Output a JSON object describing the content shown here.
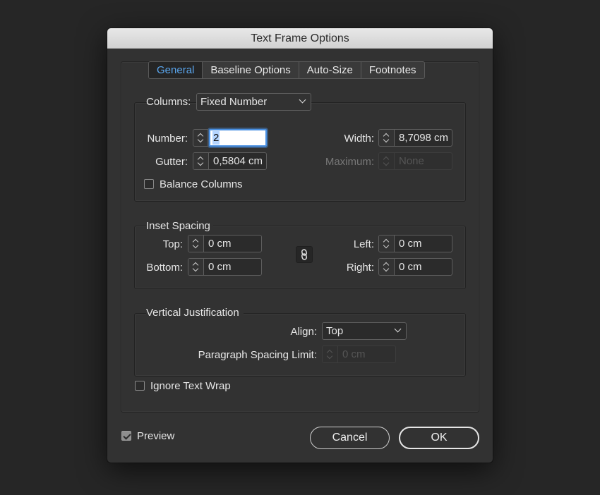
{
  "window": {
    "title": "Text Frame Options"
  },
  "tabs": [
    {
      "label": "General",
      "active": true
    },
    {
      "label": "Baseline Options",
      "active": false
    },
    {
      "label": "Auto-Size",
      "active": false
    },
    {
      "label": "Footnotes",
      "active": false
    }
  ],
  "columns": {
    "label": "Columns:",
    "dropdown_value": "Fixed Number",
    "number_label": "Number:",
    "number_value": "2",
    "gutter_label": "Gutter:",
    "gutter_value": "0,5804 cm",
    "width_label": "Width:",
    "width_value": "8,7098 cm",
    "maximum_label": "Maximum:",
    "maximum_value": "None",
    "balance_label": "Balance Columns",
    "balance_checked": false
  },
  "inset": {
    "title": "Inset Spacing",
    "top_label": "Top:",
    "top_value": "0 cm",
    "bottom_label": "Bottom:",
    "bottom_value": "0 cm",
    "left_label": "Left:",
    "left_value": "0 cm",
    "right_label": "Right:",
    "right_value": "0 cm"
  },
  "vertical": {
    "title": "Vertical Justification",
    "align_label": "Align:",
    "align_value": "Top",
    "spacing_label": "Paragraph Spacing Limit:",
    "spacing_value": "0 cm"
  },
  "ignore_wrap": {
    "label": "Ignore Text Wrap",
    "checked": false
  },
  "footer": {
    "preview_label": "Preview",
    "preview_checked": true,
    "cancel_label": "Cancel",
    "ok_label": "OK"
  },
  "colors": {
    "accent": "#5aa6ee",
    "focus_ring": "#4a90e2",
    "panel": "#323232"
  }
}
